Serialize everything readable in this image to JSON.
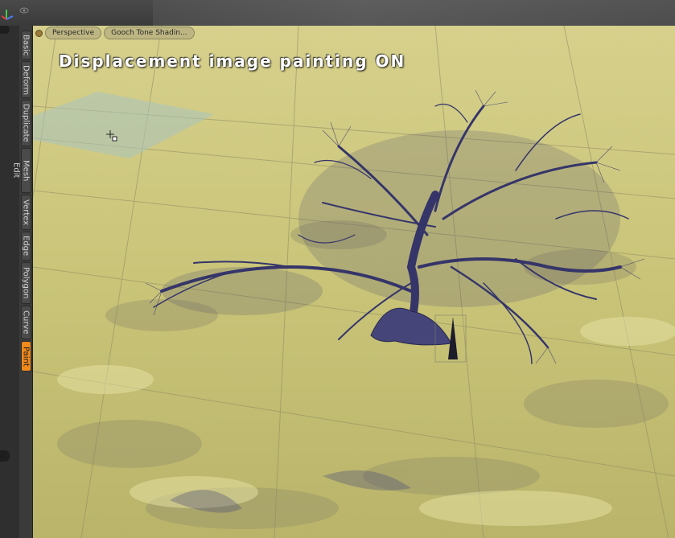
{
  "viewport": {
    "view_label": "Perspective",
    "shading_label": "Gooch Tone Shadin...",
    "overlay_message": "Displacement image painting ON"
  },
  "tool_tabs": [
    {
      "label": "Basic"
    },
    {
      "label": "Deform"
    },
    {
      "label": "Duplicate"
    },
    {
      "label": "Mesh Edit"
    },
    {
      "label": "Vertex"
    },
    {
      "label": "Edge"
    },
    {
      "label": "Polygon"
    },
    {
      "label": "Curve"
    },
    {
      "label": "Paint",
      "active": true
    }
  ],
  "colors": {
    "active_tab": "#f08a1c",
    "terrain": "#c9c47a",
    "tree": "#3a3a6a"
  },
  "icons": [
    "axis-icon",
    "eye-icon",
    "pan-icon",
    "orbit-icon",
    "zoom-icon",
    "maximize-icon",
    "paint-cursor-icon"
  ]
}
